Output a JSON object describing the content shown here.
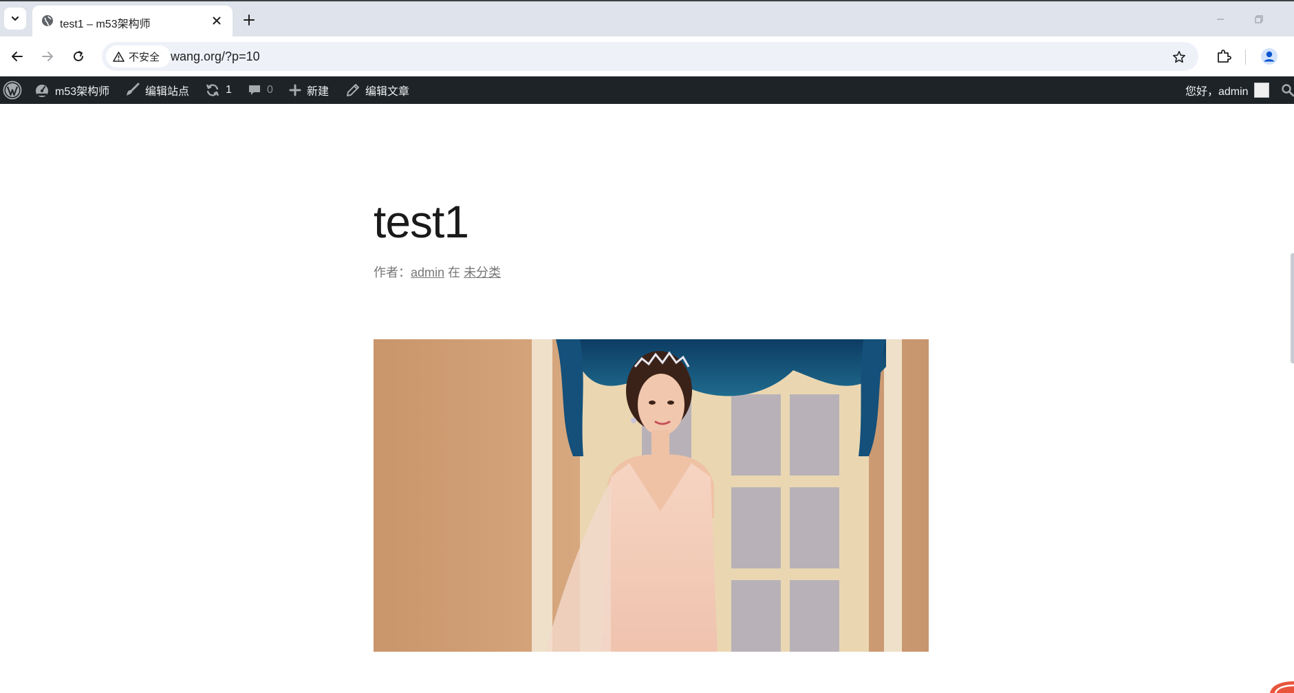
{
  "browser": {
    "tab": {
      "title": "test1 – m53架构师"
    },
    "address_bar": {
      "security_label": "不安全",
      "url": "wang.org/?p=10"
    }
  },
  "admin_bar": {
    "site_name": "m53架构师",
    "customize_label": "编辑站点",
    "updates_count": "1",
    "comments_count": "0",
    "new_label": "新建",
    "edit_post_label": "编辑文章",
    "greeting": "您好，admin"
  },
  "post": {
    "title": "test1",
    "meta": {
      "author_prefix": "作者：",
      "author": "admin",
      "category_prefix": "在",
      "category": "未分类"
    }
  },
  "colors": {
    "admin_bar_bg": "#1d2327",
    "tabstrip_bg": "#dfe3eb",
    "omnibox_bg": "#eef1f8",
    "meta_text": "#767676"
  }
}
